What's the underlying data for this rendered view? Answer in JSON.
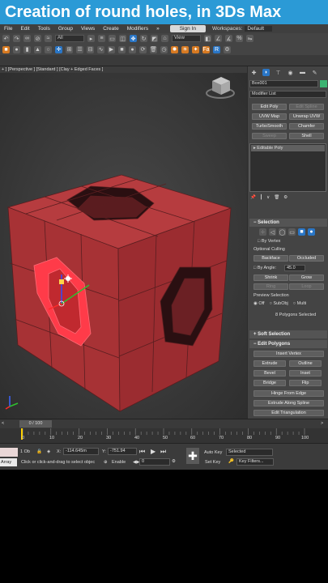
{
  "video_title": "Creation of round holes, in 3Ds Max",
  "menu": [
    "File",
    "Edit",
    "Tools",
    "Group",
    "Views",
    "Create",
    "Modifiers"
  ],
  "menu_more": "»",
  "sign_in": "Sign In",
  "workspace_label": "Workspaces:",
  "workspace_value": "Default",
  "toolbar1": {
    "filter_dropdown": "All",
    "view_dropdown": "View"
  },
  "viewport": {
    "label": "+ ] [Perspective ] [Standard ] [Clay + Edged Faces ]"
  },
  "command_panel": {
    "object_name": "Box001",
    "modifier_list": "Modifier List",
    "modifier_buttons": [
      "Edit Poly",
      "Edit Spline",
      "UVW Map",
      "Unwrap UVW",
      "TurboSmooth",
      "Chamfer",
      "Sweep",
      "Shell"
    ],
    "stack_item": "Editable Poly",
    "selection": {
      "title": "Selection",
      "by_vertex": "By Vertex",
      "ignore_culling": "Optional Culling",
      "backface": "Backface",
      "occluded": "Occluded",
      "by_angle": "By Angle:",
      "angle_value": "45.0",
      "shrink": "Shrink",
      "grow": "Grow",
      "ring": "Ring",
      "loop": "Loop",
      "preview_title": "Preview Selection",
      "preview_off": "Off",
      "preview_subobj": "SubObj",
      "preview_multi": "Multi",
      "selected_info": "8 Polygons Selected"
    },
    "soft_selection": "Soft Selection",
    "edit_polygons": {
      "title": "Edit Polygons",
      "insert_vertex": "Insert Vertex",
      "extrude": "Extrude",
      "outline": "Outline",
      "bevel": "Bevel",
      "inset": "Inset",
      "bridge": "Bridge",
      "flip": "Flip",
      "hinge": "Hinge From Edge",
      "extrude_spline": "Extrude Along Spline",
      "edit_triangulation": "Edit Triangulation"
    }
  },
  "timeline": {
    "counter": "0 / 100",
    "ticks": [
      "0",
      "10",
      "20",
      "30",
      "40",
      "50",
      "60",
      "70",
      "80",
      "90",
      "100"
    ]
  },
  "status": {
    "selection_info": "1 Ob",
    "x_label": "X:",
    "x_value": "-114.645m",
    "y_label": "Y:",
    "y_value": "-751.94",
    "prompt": "Click or click-and-drag to select objec",
    "array_label": "Array",
    "enable_label": "Enable",
    "frame_value": "0",
    "auto_key": "Auto Key",
    "selected_dd": "Selected",
    "set_key": "Set Key",
    "key_filters": "Key Filters..."
  },
  "colors": {
    "accent": "#2b9ad6",
    "cube": "#b8383c",
    "selection": "#ff3040"
  }
}
